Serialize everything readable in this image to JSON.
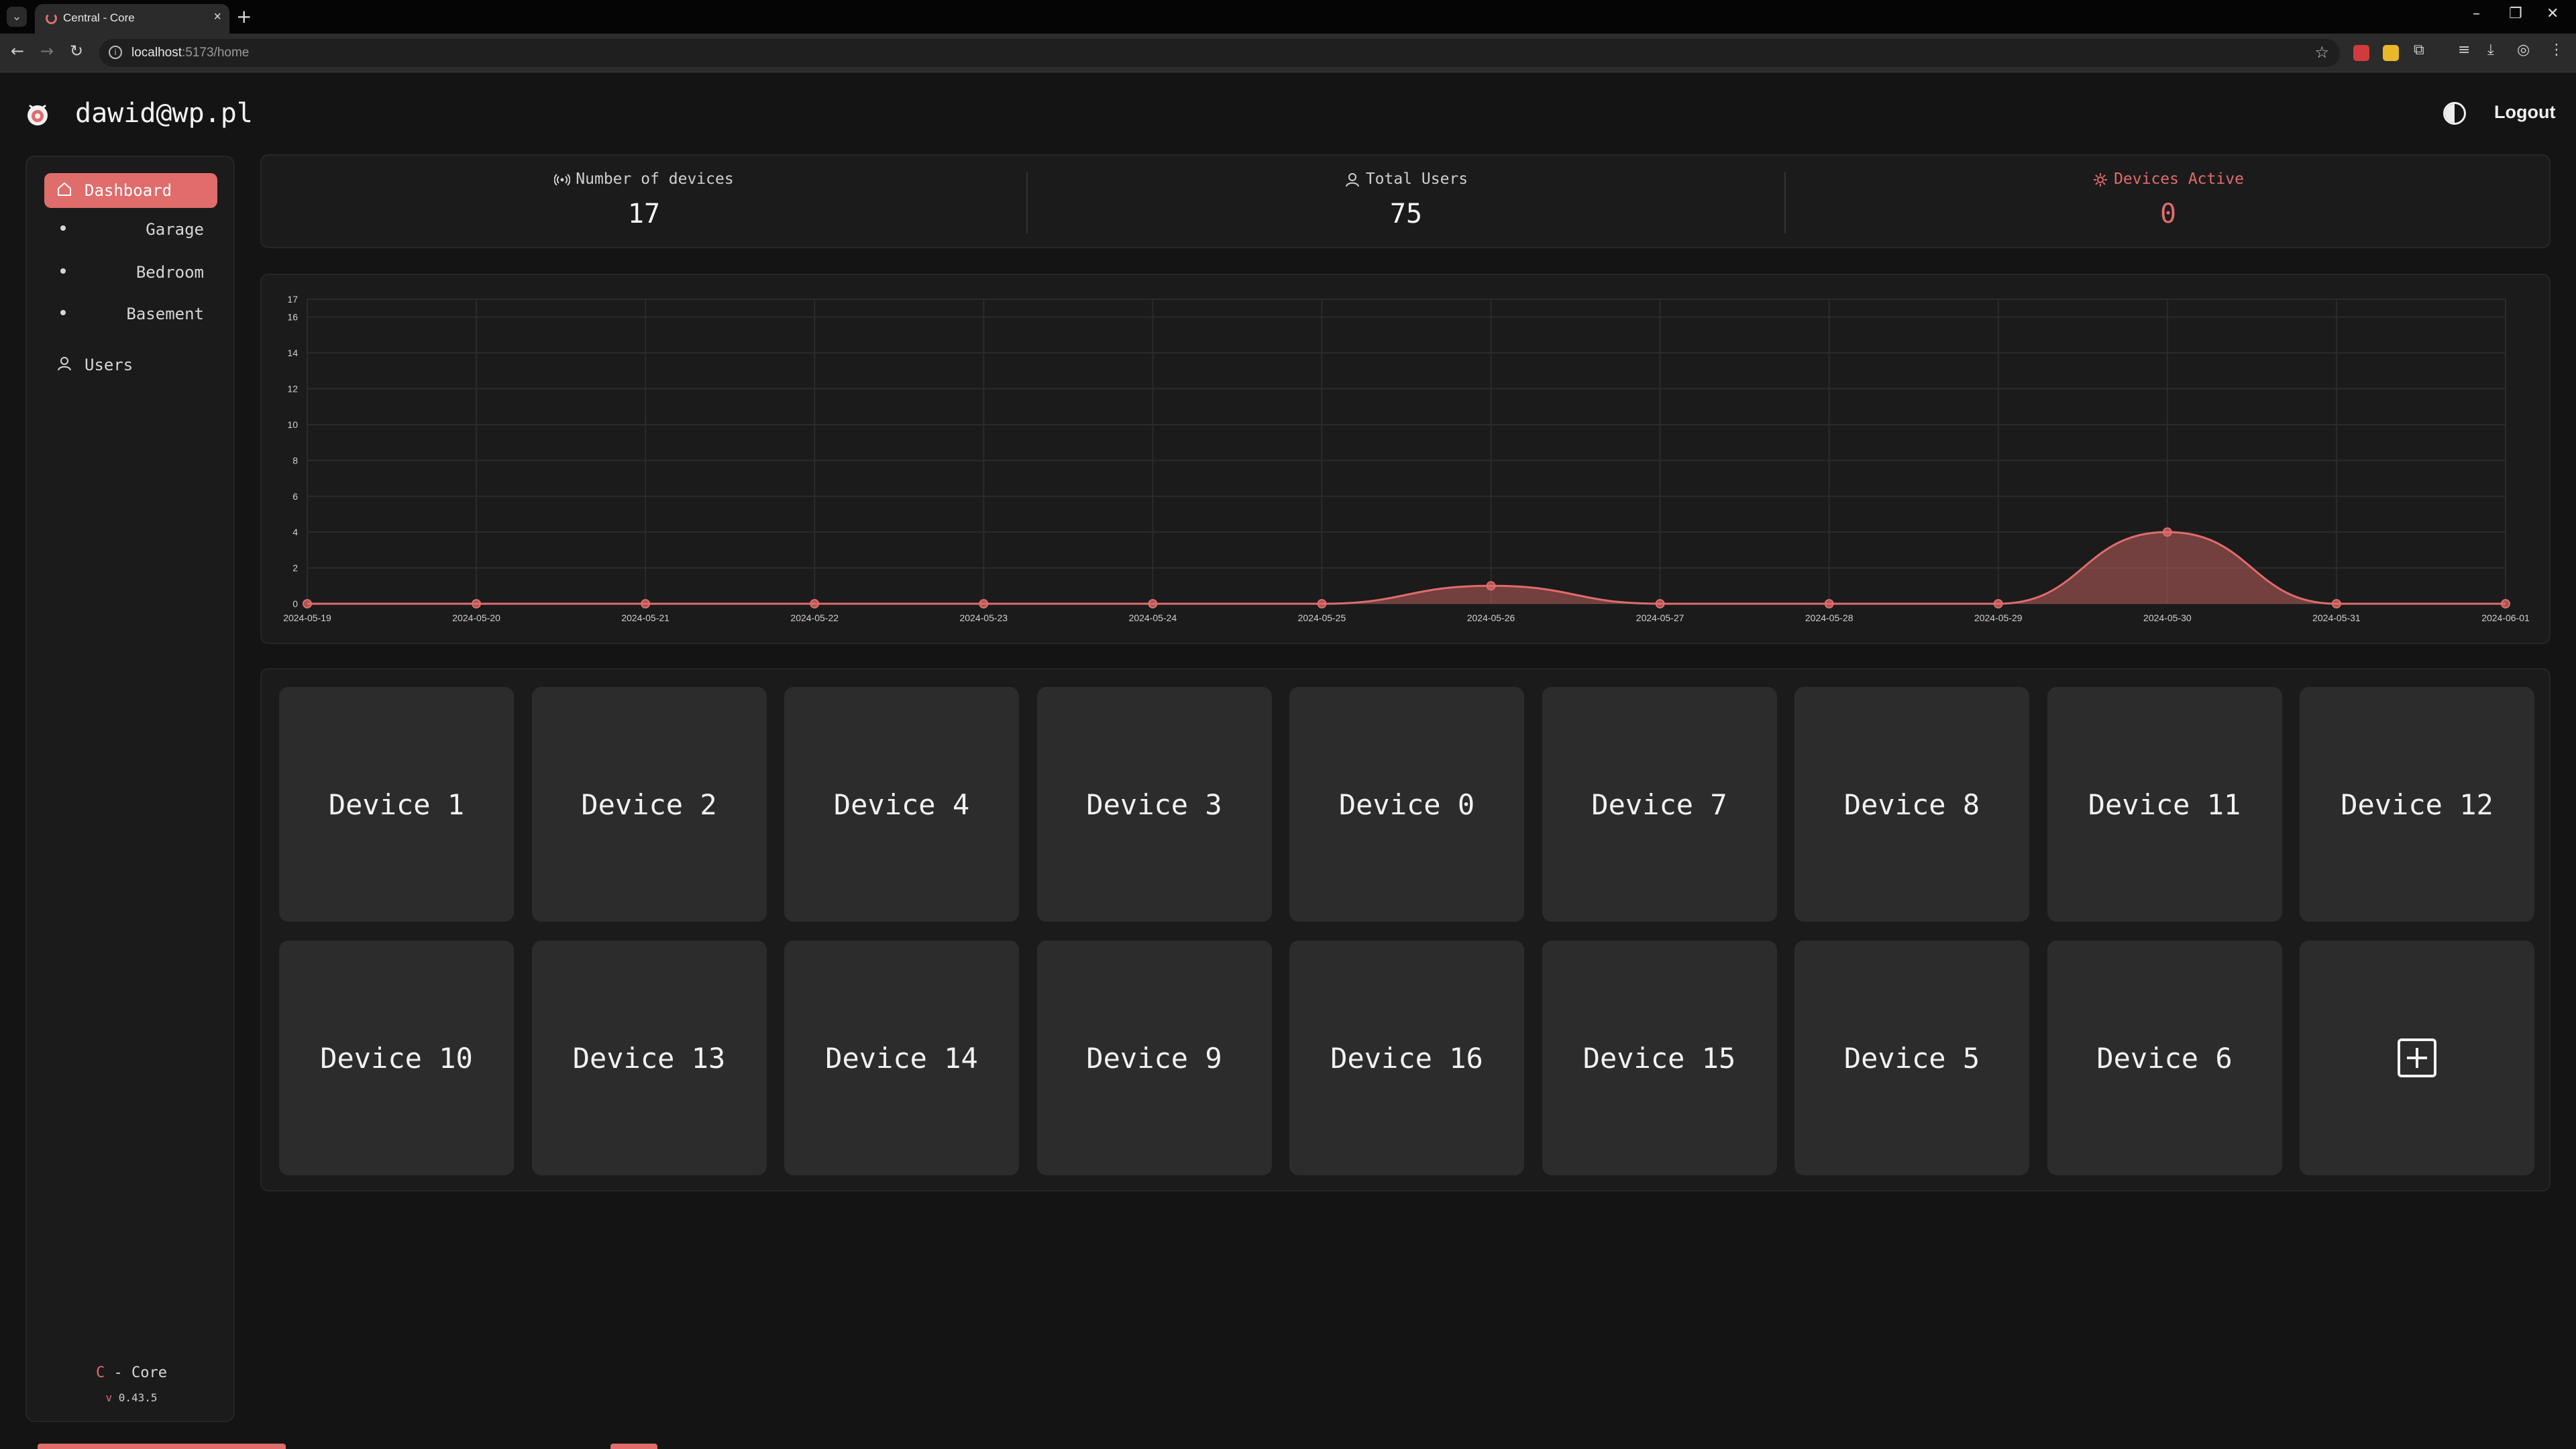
{
  "browser": {
    "tab_title": "Central - Core",
    "url_host": "localhost",
    "url_path": ":5173/home"
  },
  "header": {
    "user_email": "dawid@wp.pl",
    "logout_label": "Logout"
  },
  "sidebar": {
    "dashboard_label": "Dashboard",
    "rooms": [
      "Garage",
      "Bedroom",
      "Basement"
    ],
    "users_label": "Users",
    "brand_c": "C",
    "brand_rest": " - Core",
    "version_v": "v",
    "version_num": " 0.43.5"
  },
  "stats": {
    "devices_title": "Number of devices",
    "devices_value": "17",
    "users_title": "Total Users",
    "users_value": "75",
    "active_title": "Devices Active",
    "active_value": "0"
  },
  "chart_data": {
    "type": "area",
    "x": [
      "2024-05-19",
      "2024-05-20",
      "2024-05-21",
      "2024-05-22",
      "2024-05-23",
      "2024-05-24",
      "2024-05-25",
      "2024-05-26",
      "2024-05-27",
      "2024-05-28",
      "2024-05-29",
      "2024-05-30",
      "2024-05-31",
      "2024-06-01"
    ],
    "values": [
      0,
      0,
      0,
      0,
      0,
      0,
      0,
      1,
      0,
      0,
      0,
      4,
      0,
      0
    ],
    "yticks": [
      0,
      2,
      4,
      6,
      8,
      10,
      12,
      14,
      16,
      17
    ],
    "ylim": [
      0,
      17
    ],
    "grid": true,
    "color": "#e06c6c"
  },
  "devices": [
    "Device 1",
    "Device 2",
    "Device 4",
    "Device 3",
    "Device 0",
    "Device 7",
    "Device 8",
    "Device 11",
    "Device 12",
    "Device 10",
    "Device 13",
    "Device 14",
    "Device 9",
    "Device 16",
    "Device 15",
    "Device 5",
    "Device 6"
  ],
  "colors": {
    "accent": "#e06c6c",
    "background": "#141414",
    "card": "#1b1b1b",
    "tile": "#2c2c2c"
  }
}
